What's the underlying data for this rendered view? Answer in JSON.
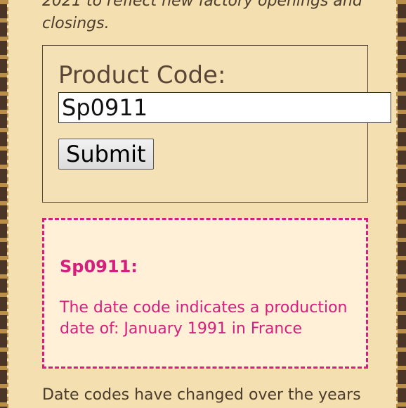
{
  "intro": {
    "text": "2021 to reflect new factory openings and closings."
  },
  "form": {
    "label": "Product Code:",
    "input_value": "Sp0911",
    "submit_label": "Submit"
  },
  "result": {
    "code": "Sp0911:",
    "message": "The date code indicates a production date of: January 1991 in France"
  },
  "outro": {
    "text": "Date codes have changed over the years"
  },
  "colors": {
    "page_bg": "#f4dfb1",
    "result_accent": "#d51e7d",
    "text": "#4b3b2a"
  }
}
